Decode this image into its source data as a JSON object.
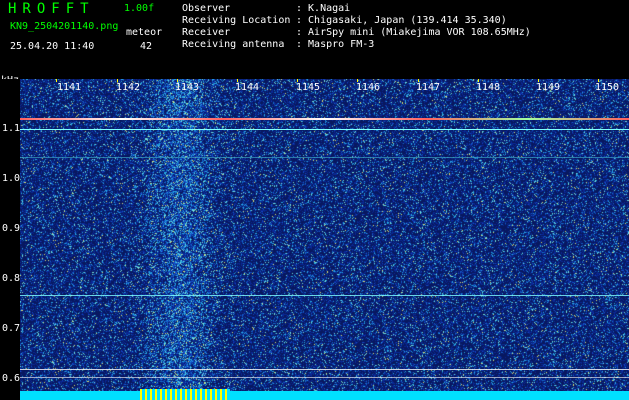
{
  "header": {
    "app_title": "HROFFT",
    "version": "1.00f",
    "filename": "KN9_2504201140.png",
    "meteor_label": "meteor",
    "datetime": "25.04.20 11:40",
    "meteor_count": "42"
  },
  "info": [
    {
      "label": "Observer",
      "value": ": K.Nagai"
    },
    {
      "label": "Receiving Location",
      "value": ": Chigasaki, Japan (139.414 35.340)"
    },
    {
      "label": "Receiver",
      "value": ": AirSpy mini (Miakejima VOR 108.65MHz)"
    },
    {
      "label": "Receiving antenna",
      "value": ": Maspro FM-3"
    }
  ],
  "axis": {
    "unit": "kHz",
    "y_ticks": [
      "1.1",
      "1.0",
      "0.9",
      "0.8",
      "0.7",
      "0.6"
    ],
    "x_ticks": [
      "1141",
      "1142",
      "1143",
      "1144",
      "1145",
      "1146",
      "1147",
      "1148",
      "1149",
      "1150"
    ]
  },
  "colors": {
    "background": "#081860",
    "carrier_line": "#ff6060",
    "horizontal_line": "#80ffff",
    "noise_bar": "#00e0ff",
    "meteor_burst": "#ffff00",
    "header_accent": "#00ff00"
  }
}
